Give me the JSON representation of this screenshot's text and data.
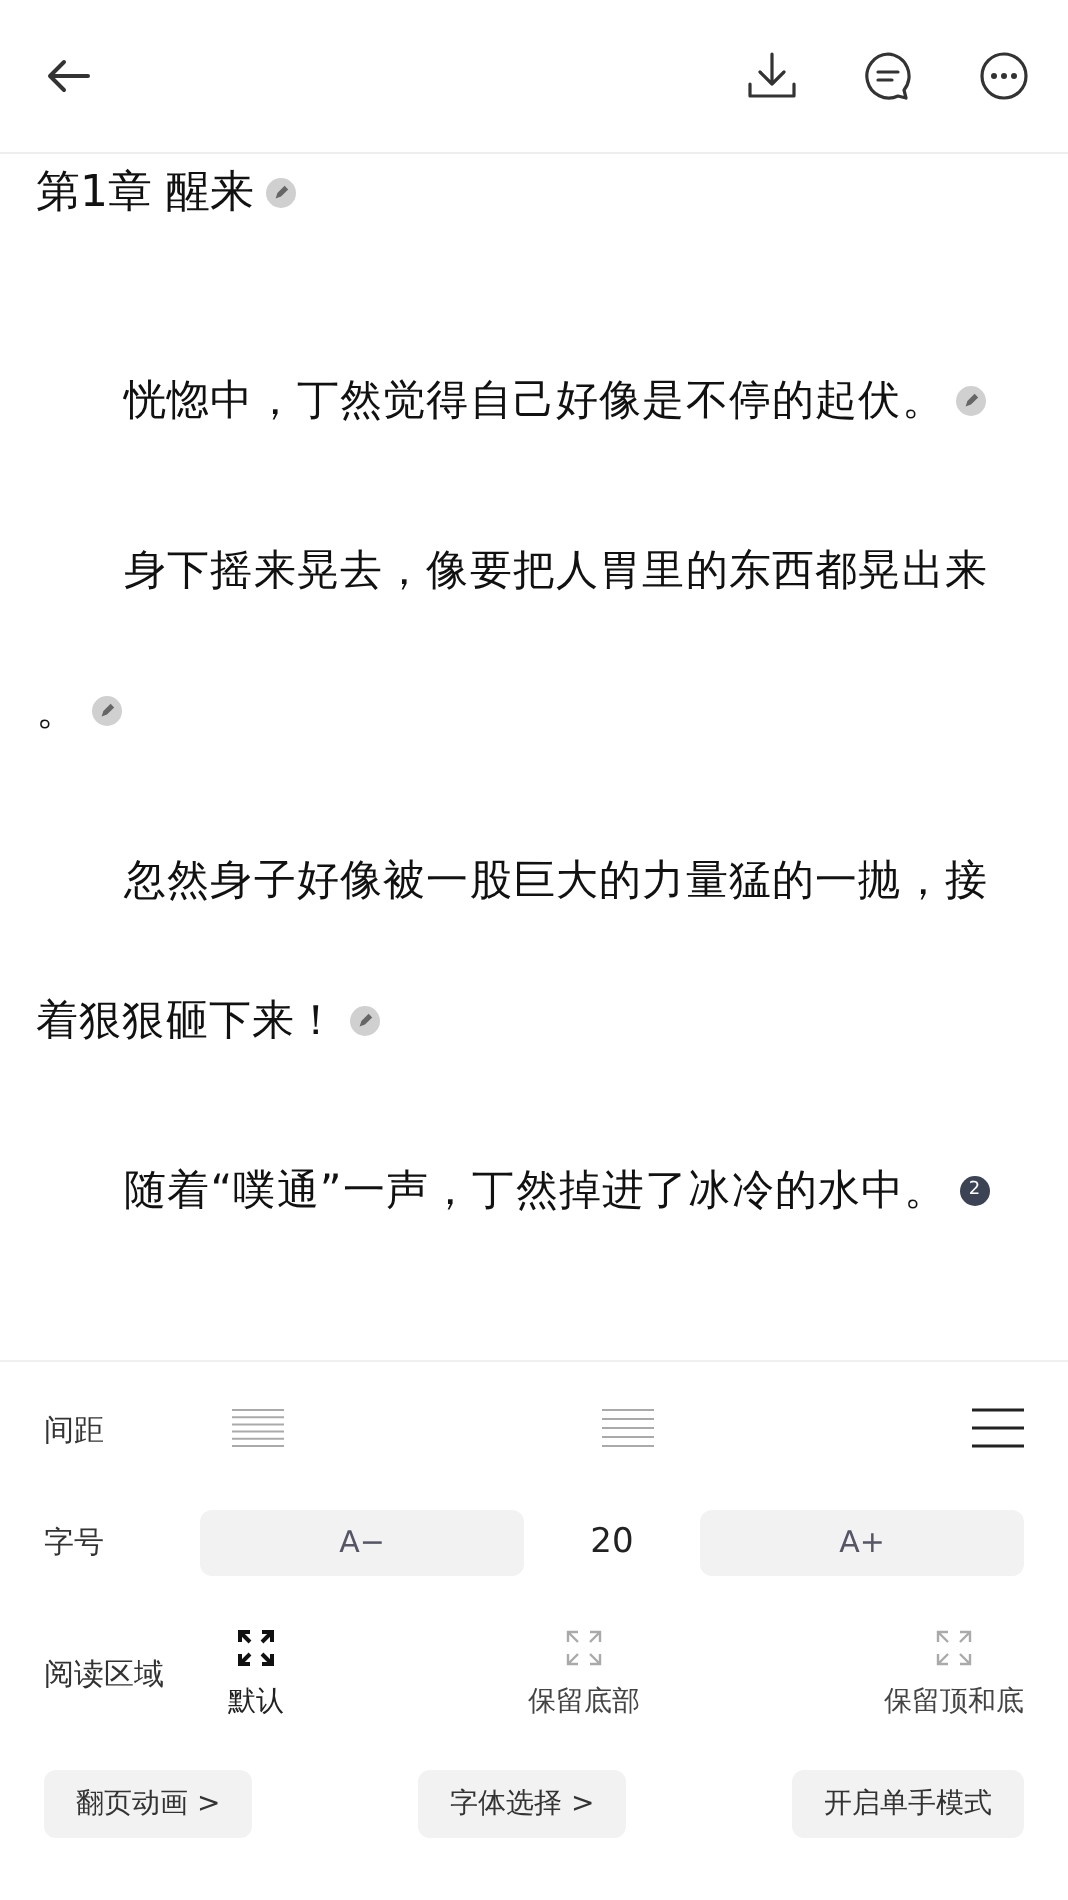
{
  "chapter": {
    "title": "第1章 醒来",
    "note": {
      "kind": "edit"
    }
  },
  "paragraphs": [
    {
      "lines": [
        "恍惚中，丁然觉得自己好像是不停的起伏。"
      ],
      "note": {
        "kind": "edit"
      }
    },
    {
      "lines": [
        "身下摇来晃去，像要把人胃里的东西都晃出来",
        "。"
      ],
      "note": {
        "kind": "edit"
      }
    },
    {
      "lines": [
        "忽然身子好像被一股巨大的力量猛的一抛，接",
        "着狠狠砸下来！"
      ],
      "note": {
        "kind": "edit"
      }
    },
    {
      "lines": [
        "随着“噗通”一声，丁然掉进了冰冷的水中。"
      ],
      "note": {
        "kind": "count",
        "count": "2"
      }
    }
  ],
  "settings": {
    "spacing": {
      "label": "间距",
      "options": [
        {
          "kind": "dense",
          "selected": false
        },
        {
          "kind": "medium",
          "selected": false
        },
        {
          "kind": "loose",
          "selected": true
        }
      ]
    },
    "font_size": {
      "label": "字号",
      "decrease": "A−",
      "value": "20",
      "increase": "A+"
    },
    "reading_area": {
      "label": "阅读区域",
      "options": [
        {
          "label": "默认",
          "selected": true
        },
        {
          "label": "保留底部",
          "selected": false
        },
        {
          "label": "保留顶和底",
          "selected": false
        }
      ]
    },
    "buttons": [
      "翻页动画 >",
      "字体选择 >",
      "开启单手模式"
    ]
  }
}
